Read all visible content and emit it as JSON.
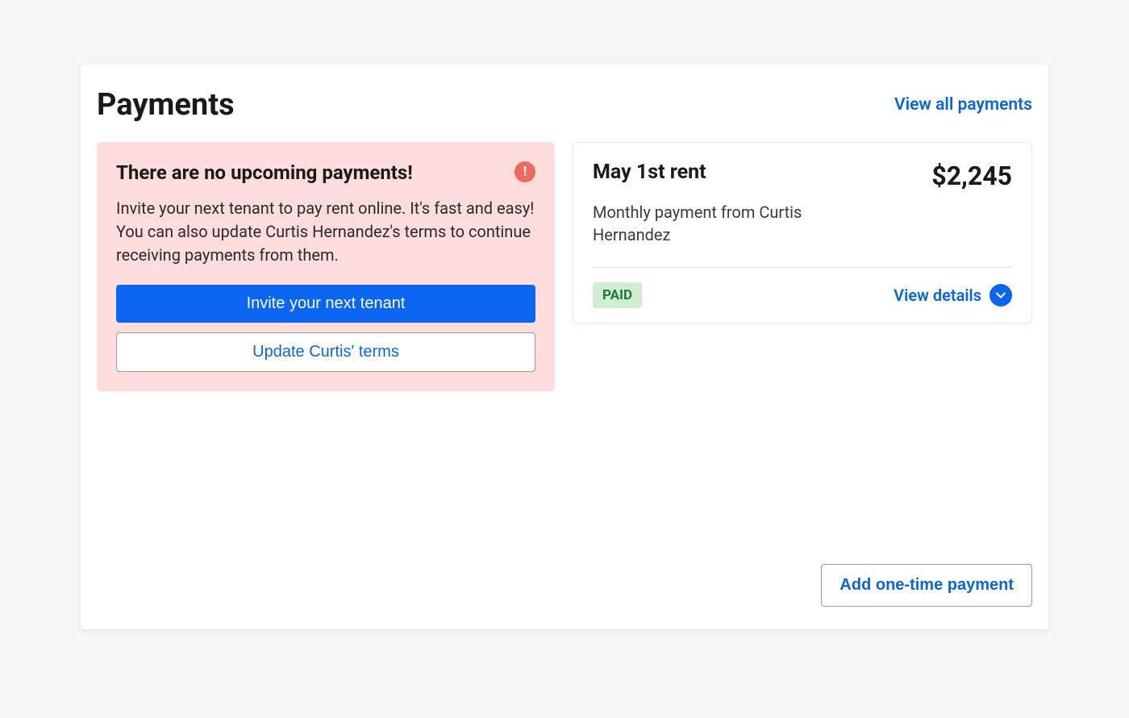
{
  "header": {
    "title": "Payments",
    "view_all_link": "View all payments"
  },
  "alert": {
    "title": "There are no upcoming payments!",
    "body": "Invite your next tenant to pay rent online. It's fast and easy! You can also update Curtis Hernandez's terms to continue receiving payments from them.",
    "invite_button": "Invite your next tenant",
    "update_terms_button": "Update Curtis' terms"
  },
  "payment": {
    "title": "May 1st rent",
    "amount": "$2,245",
    "description": "Monthly payment from Curtis Hernandez",
    "status_badge": "PAID",
    "view_details_label": "View details"
  },
  "footer": {
    "add_payment_button": "Add one-time payment"
  }
}
